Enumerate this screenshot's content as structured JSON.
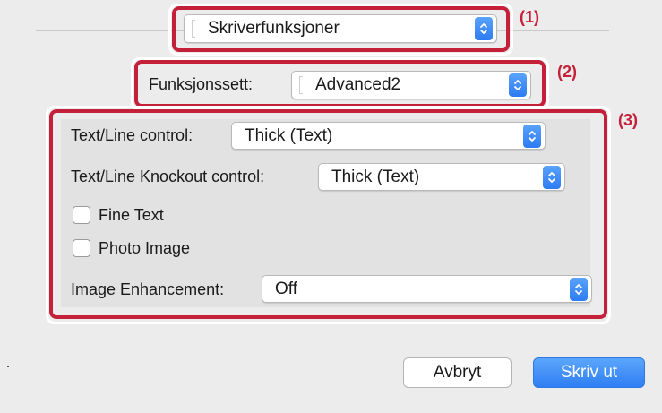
{
  "print_dialog": {
    "panel_select": {
      "value": "Skriverfunksjoner"
    },
    "feature_set": {
      "label": "Funksjonssett:",
      "value": "Advanced2"
    },
    "options": {
      "text_line_control": {
        "label": "Text/Line control:",
        "value": "Thick (Text)"
      },
      "text_line_knockout_control": {
        "label": "Text/Line Knockout control:",
        "value": "Thick (Text)"
      },
      "fine_text": {
        "label": "Fine Text",
        "checked": false
      },
      "photo_image": {
        "label": "Photo Image",
        "checked": false
      },
      "image_enhancement": {
        "label": "Image Enhancement:",
        "value": "Off"
      }
    },
    "buttons": {
      "cancel": "Avbryt",
      "print": "Skriv ut"
    }
  },
  "callouts": {
    "c1": "(1)",
    "c2": "(2)",
    "c3": "(3)"
  },
  "colors": {
    "highlight": "#c5203a",
    "accent": "#2f7ef3",
    "panel_bg": "#e2e2e2",
    "window_bg": "#ececec"
  },
  "icons": {
    "stepper": "up-down-chevron-icon"
  }
}
